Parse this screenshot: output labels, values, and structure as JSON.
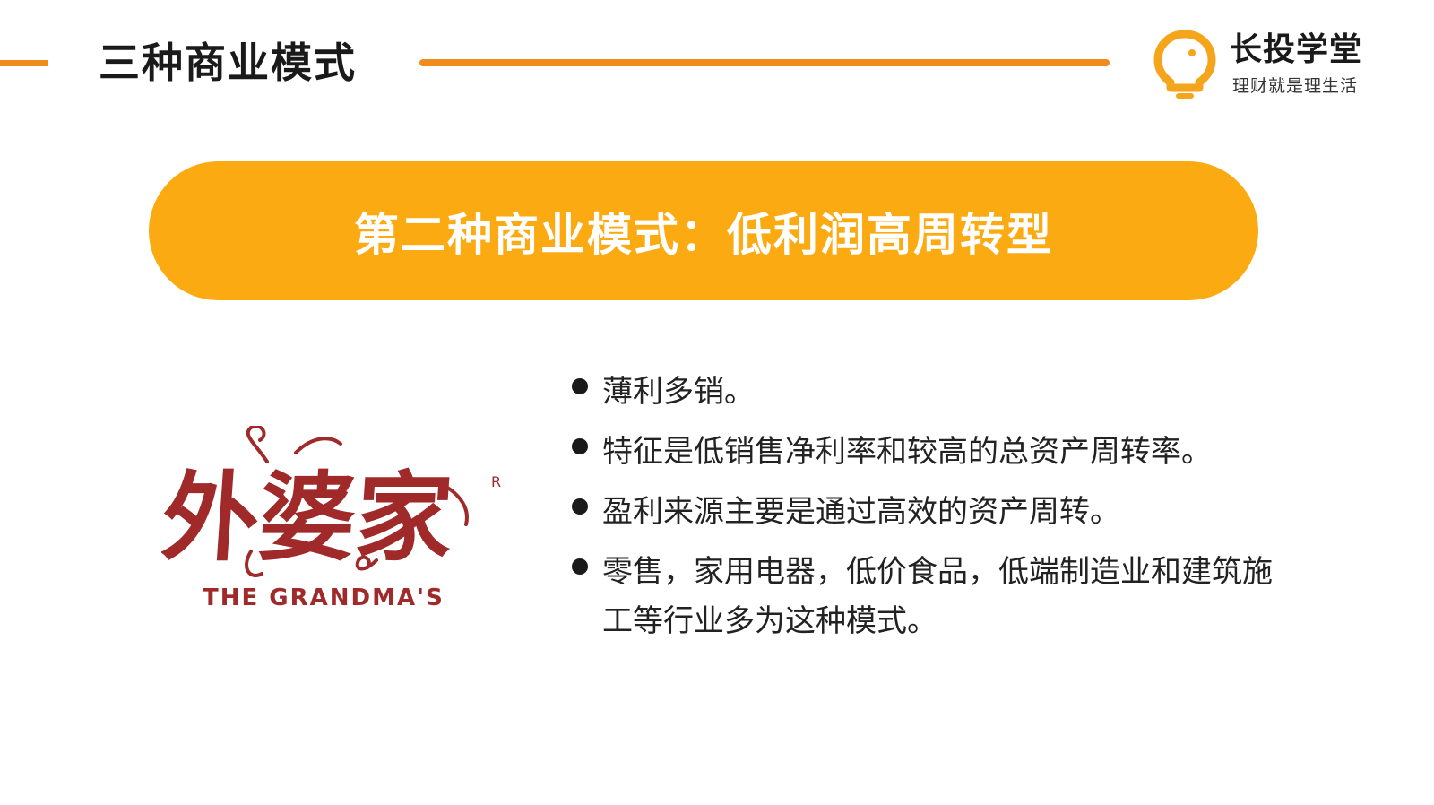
{
  "header": {
    "title": "三种商业模式",
    "accent_color": "#F08C1E"
  },
  "logo": {
    "name": "长投学堂",
    "slogan": "理财就是理生活",
    "icon": "lightbulb-icon",
    "color": "#F5A51C"
  },
  "banner": {
    "text": "第二种商业模式：低利润高周转型",
    "color": "#FBAA12"
  },
  "brand": {
    "chinese_name": "外婆家",
    "english_name": "THE GRANDMA'S",
    "registered_mark": "R",
    "color": "#A02A2A"
  },
  "bullets": [
    {
      "text": "薄利多销。"
    },
    {
      "text": "特征是低销售净利率和较高的总资产周转率。"
    },
    {
      "text": "盈利来源主要是通过高效的资产周转。"
    },
    {
      "text": "零售，家用电器，低价食品，低端制造业和建筑施工等行业多为这种模式。"
    }
  ]
}
